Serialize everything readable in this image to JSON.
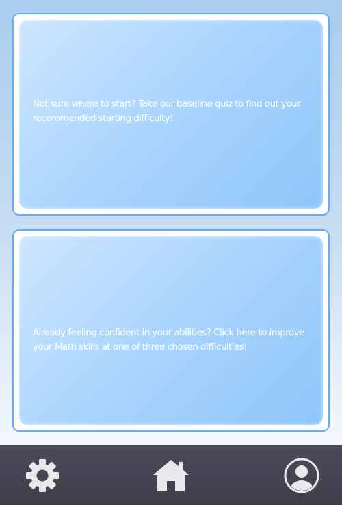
{
  "cards": [
    {
      "text": "Not sure where to start? Take our baseline quiz to find out your recommended starting difficulty!"
    },
    {
      "text": "Already feeling confident in your abilities? Click here to improve your Math skills at one of three chosen difficulties!"
    }
  ],
  "bottom_nav": {
    "items": [
      {
        "icon": "gear-icon"
      },
      {
        "icon": "home-icon"
      },
      {
        "icon": "user-icon"
      }
    ]
  },
  "colors": {
    "card_border": "#62b0f2",
    "card_fill": "#a9d4fd",
    "nav_bg": "#454553",
    "icon": "#e9e9ec",
    "text": "#ffffff"
  }
}
